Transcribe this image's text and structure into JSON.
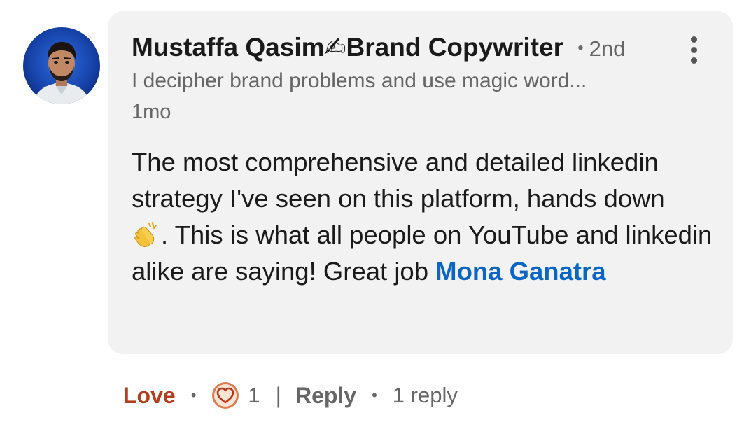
{
  "comment": {
    "author": {
      "name": "Mustaffa Qasim",
      "name_emoji": "✍",
      "title_suffix": "Brand Copywriter",
      "separator": "•",
      "connection_degree": "2nd",
      "headline": "I decipher brand problems and use magic word...",
      "avatar_icon": "profile-photo"
    },
    "timestamp": "1mo",
    "body": {
      "line1": "The most comprehensive and detailed linkedin strategy I've seen on this platform, hands down",
      "emoji": "clapping-hands-icon",
      "line2": ". This is what all people on YouTube and linkedin alike are saying! Great job ",
      "mention": "Mona Ganatra"
    },
    "menu_icon": "more-vertical-icon"
  },
  "actions": {
    "reaction_label": "Love",
    "dot": "•",
    "reaction_icon": "heart-reaction-icon",
    "reaction_count": "1",
    "pipe": "|",
    "reply_label": "Reply",
    "reply_count_text": "1 reply"
  },
  "colors": {
    "bubble_bg": "#f2f2f2",
    "love": "#b24020",
    "mention": "#0a66c2",
    "heart_fill": "#e07a4f",
    "heart_inner": "#fbe3d6",
    "muted_text": "#666666"
  }
}
